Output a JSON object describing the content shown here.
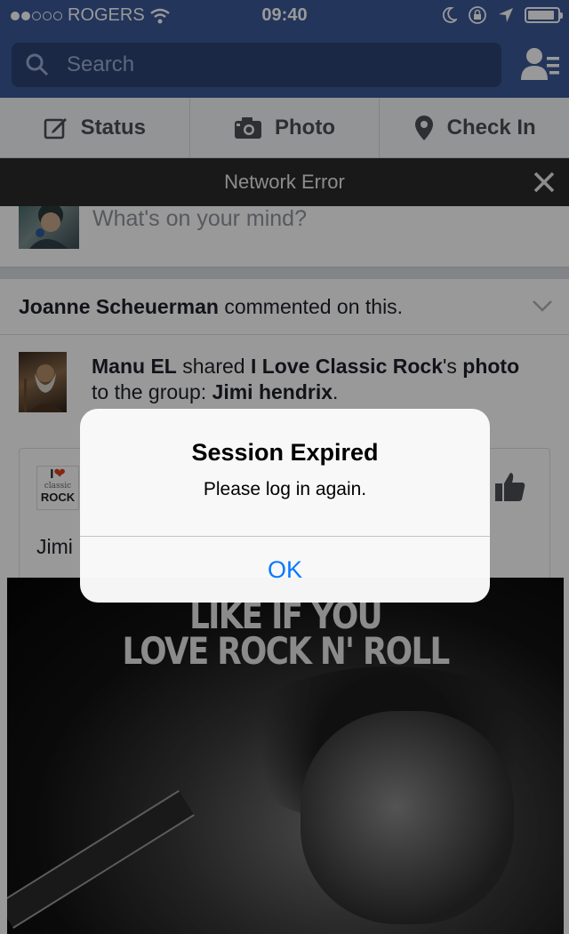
{
  "status_bar": {
    "carrier": "ROGERS",
    "time": "09:40",
    "signal_bars_filled": 2,
    "signal_bars_total": 5,
    "battery_level": 0.92
  },
  "header": {
    "search_placeholder": "Search",
    "icons": [
      "search-icon",
      "friend-requests-icon"
    ]
  },
  "composer": {
    "status_label": "Status",
    "photo_label": "Photo",
    "checkin_label": "Check In"
  },
  "network_error": {
    "text": "Network Error"
  },
  "feed": {
    "whats_on_mind": "What's on your mind?",
    "story_actor": "Joanne Scheuerman",
    "story_action": " commented on this.",
    "shared_author": "Manu EL",
    "shared_verb": " shared ",
    "shared_page": "I Love Classic Rock",
    "shared_suffix": "'s ",
    "shared_object": "photo",
    "shared_line2_prefix": "to the group: ",
    "shared_group": "Jimi hendrix",
    "shared_end": ".",
    "card_text": "Jimi",
    "logo_top": "I",
    "logo_mid": "classic",
    "logo_bottom": "ROCK",
    "photo_line1": "LIKE IF YOU",
    "photo_line2": "LOVE ROCK N' ROLL"
  },
  "alert": {
    "title": "Session Expired",
    "message": "Please log in again.",
    "ok_label": "OK"
  },
  "colors": {
    "facebook_blue": "#3b5998",
    "ios_blue": "#0a79ff",
    "error_bar": "#2b2b2b"
  }
}
